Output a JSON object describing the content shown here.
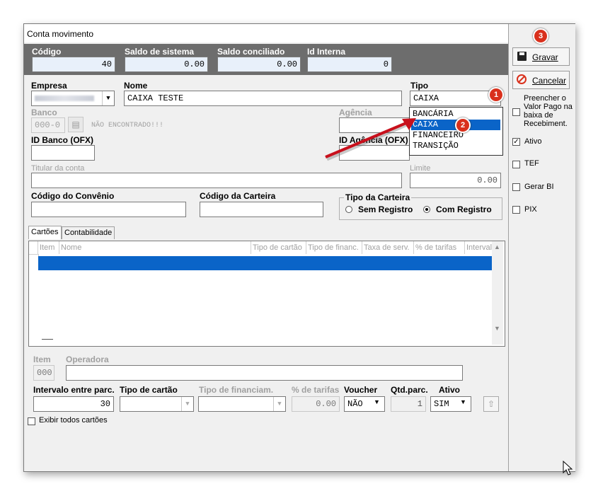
{
  "window": {
    "title": "Conta movimento"
  },
  "header": {
    "codigo_label": "Código",
    "codigo_value": "40",
    "saldo_sistema_label": "Saldo de sistema",
    "saldo_sistema_value": "0.00",
    "saldo_conciliado_label": "Saldo conciliado",
    "saldo_conciliado_value": "0.00",
    "id_interna_label": "Id Interna",
    "id_interna_value": "0"
  },
  "form": {
    "empresa_label": "Empresa",
    "nome_label": "Nome",
    "nome_value": "CAIXA TESTE",
    "tipo_label": "Tipo",
    "tipo_value": "CAIXA",
    "banco_label": "Banco",
    "banco_value": "000-0",
    "banco_status": "NÃO ENCONTRADO!!!",
    "agencia_label": "Agência",
    "id_banco_label": "ID Banco (OFX)",
    "id_agencia_label": "ID Agência (OFX)",
    "titular_label": "Titular da conta",
    "limite_label": "Limite",
    "limite_value": "0.00",
    "convenio_label": "Código do Convênio",
    "carteira_label": "Código da Carteira",
    "tipo_carteira_label": "Tipo da Carteira",
    "sem_registro": "Sem Registro",
    "com_registro": "Com Registro"
  },
  "tipo_dropdown": {
    "options": [
      "BANCÁRIA",
      "CAIXA",
      "FINANCEIRO",
      "TRANSIÇÃO"
    ]
  },
  "tabs": [
    "Cartões",
    "Contabilidade"
  ],
  "grid": {
    "columns": [
      "Item",
      "Nome",
      "Tipo de cartão",
      "Tipo de financ.",
      "Taxa de serv.",
      "% de tarifas",
      "Interval"
    ]
  },
  "detail": {
    "item_label": "Item",
    "item_value": "000",
    "operadora_label": "Operadora",
    "intervalo_label": "Intervalo entre parc.",
    "intervalo_value": "30",
    "tipo_cartao_label": "Tipo de cartão",
    "tipo_financ_label": "Tipo de financiam.",
    "tarifas_label": "% de tarifas",
    "tarifas_value": "0.00",
    "voucher_label": "Voucher",
    "voucher_value": "NÃO",
    "qtd_parc_label": "Qtd.parc.",
    "qtd_parc_value": "1",
    "ativo_label": "Ativo",
    "ativo_value": "SIM",
    "exibir_label": "Exibir todos cartões"
  },
  "side": {
    "gravar": "Gravar",
    "cancelar": "Cancelar",
    "preencher": "Preencher o Valor Pago na baixa de Recebiment.",
    "ativo": "Ativo",
    "tef": "TEF",
    "gerar_bi": "Gerar BI",
    "pix": "PIX"
  },
  "badges": [
    "1",
    "2",
    "3"
  ],
  "colors": {
    "accent": "#0a64c8",
    "badge": "#d9301c",
    "header_band": "#6d6d6d"
  }
}
